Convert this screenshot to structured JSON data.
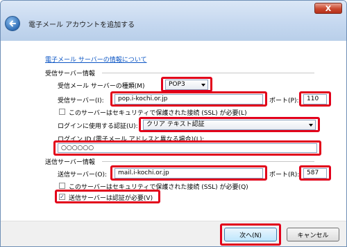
{
  "window": {
    "title": "電子メール アカウントを追加する",
    "close_glyph": "X",
    "back_glyph": "←"
  },
  "help_link": "電子メール サーバーの情報について",
  "incoming": {
    "section_title": "受信サーバー情報",
    "server_type_label": "受信メール サーバーの種類(M)",
    "server_type_value": "POP3",
    "server_label": "受信サーバー(I):",
    "server_value": "pop.i-kochi.or.jp",
    "port_label": "ポート(P):",
    "port_value": "110",
    "ssl_label": "このサーバーはセキュリティで保護された接続 (SSL) が必要(L)",
    "ssl_checked": false,
    "auth_label": "ログインに使用する認証(U):",
    "auth_value": "クリア テキスト認証",
    "login_id_label": "ログイン ID (電子メール アドレスと異なる場合)(L):",
    "login_id_value": "○○○○○○"
  },
  "outgoing": {
    "section_title": "送信サーバー情報",
    "server_label": "送信サーバー(O):",
    "server_value": "mail.i-kochi.or.jp",
    "port_label": "ポート(R):",
    "port_value": "587",
    "ssl_label": "このサーバーはセキュリティで保護された接続 (SSL) が必要(Q)",
    "ssl_checked": false,
    "auth_required_label": "送信サーバーは認証が必要(V)",
    "auth_required_checked": true,
    "check_mark": "✓"
  },
  "buttons": {
    "next": "次へ(N)",
    "cancel": "キャンセル"
  },
  "colors": {
    "highlight": "#e2001a",
    "link": "#0b55c4",
    "title_bar": "#c4d7ef"
  }
}
